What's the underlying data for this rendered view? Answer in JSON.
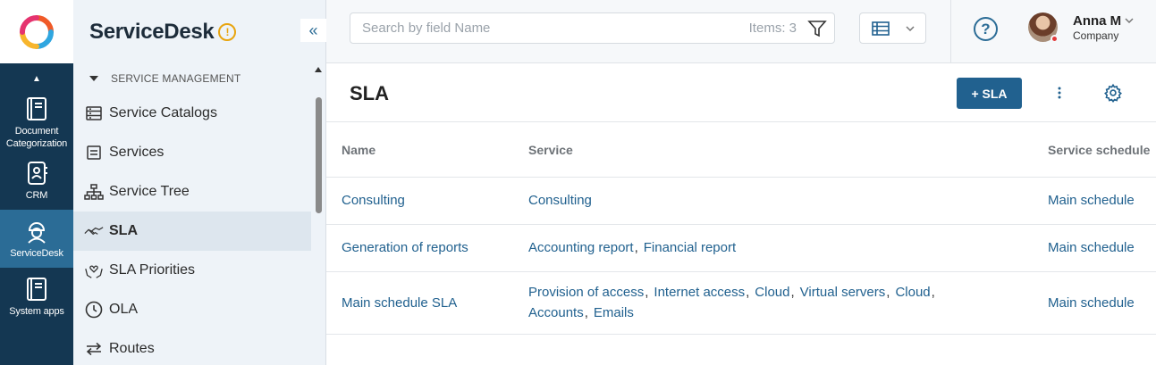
{
  "app_rail": {
    "items": [
      {
        "label": "Document Categorization",
        "icon": "book-icon"
      },
      {
        "label": "CRM",
        "icon": "contact-card-icon"
      },
      {
        "label": "ServiceDesk",
        "icon": "worker-helmet-icon",
        "active": true
      },
      {
        "label": "System apps",
        "icon": "book-icon"
      }
    ]
  },
  "sidebar": {
    "title": "ServiceDesk",
    "warning_badge": "!",
    "collapse_icon": "«",
    "group_label": "SERVICE MANAGEMENT",
    "items": [
      {
        "label": "Service Catalogs",
        "icon": "catalog-icon"
      },
      {
        "label": "Services",
        "icon": "services-icon"
      },
      {
        "label": "Service Tree",
        "icon": "tree-icon"
      },
      {
        "label": "SLA",
        "icon": "handshake-icon",
        "active": true
      },
      {
        "label": "SLA Priorities",
        "icon": "hands-heart-icon"
      },
      {
        "label": "OLA",
        "icon": "clock-icon"
      },
      {
        "label": "Routes",
        "icon": "arrows-icon"
      }
    ]
  },
  "topbar": {
    "search_placeholder": "Search by field Name",
    "items_count": "Items: 3",
    "help_label": "?",
    "user": {
      "name": "Anna M",
      "company": "Company"
    }
  },
  "page": {
    "title": "SLA",
    "add_button": "+ SLA"
  },
  "table": {
    "headers": [
      "Name",
      "Service",
      "Service schedule"
    ],
    "rows": [
      {
        "name": "Consulting",
        "services": [
          "Consulting"
        ],
        "schedule": "Main schedule"
      },
      {
        "name": "Generation of reports",
        "services": [
          "Accounting report",
          "Financial report"
        ],
        "schedule": "Main schedule"
      },
      {
        "name": "Main schedule SLA",
        "services": [
          "Provision of access",
          "Internet access",
          "Cloud",
          "Virtual servers",
          "Cloud",
          "Accounts",
          "Emails"
        ],
        "schedule": "Main schedule"
      }
    ]
  },
  "colors": {
    "rail_bg": "#143752",
    "rail_active": "#2b6c96",
    "sidebar_bg": "#eef3f8",
    "accent": "#21618f",
    "warning": "#e8a40e"
  }
}
